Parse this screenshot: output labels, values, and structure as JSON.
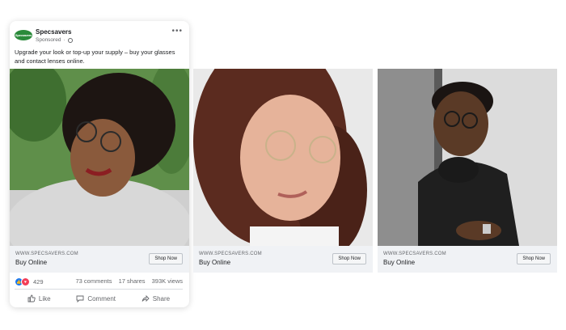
{
  "ad": {
    "brand_name": "Specsavers",
    "logo_text": "Specsavers",
    "sponsored_label": "Sponsored",
    "body_text": "Upgrade your look or top-up your supply – buy your glasses and contact lenses online."
  },
  "carousel": [
    {
      "url": "WWW.SPECSAVERS.COM",
      "headline": "Buy Online",
      "button": "Shop Now"
    },
    {
      "url": "WWW.SPECSAVERS.COM",
      "headline": "Buy Online",
      "button": "Shop Now"
    },
    {
      "url": "WWW.SPECSAVERS.COM",
      "headline": "Buy Online",
      "button": "Shop Now"
    }
  ],
  "engagement": {
    "reactions_count": "429",
    "comments": "73 comments",
    "shares": "17 shares",
    "views": "393K views"
  },
  "actions": {
    "like": "Like",
    "comment": "Comment",
    "share": "Share"
  },
  "colors": {
    "brand_green": "#2a8a3a",
    "like_blue": "#1877f2",
    "love_red": "#f33e58",
    "footer_bg": "#f0f2f5"
  },
  "icons": [
    "globe-icon",
    "more-icon",
    "like-reaction-icon",
    "love-reaction-icon",
    "thumbs-up-icon",
    "comment-icon",
    "share-icon"
  ]
}
